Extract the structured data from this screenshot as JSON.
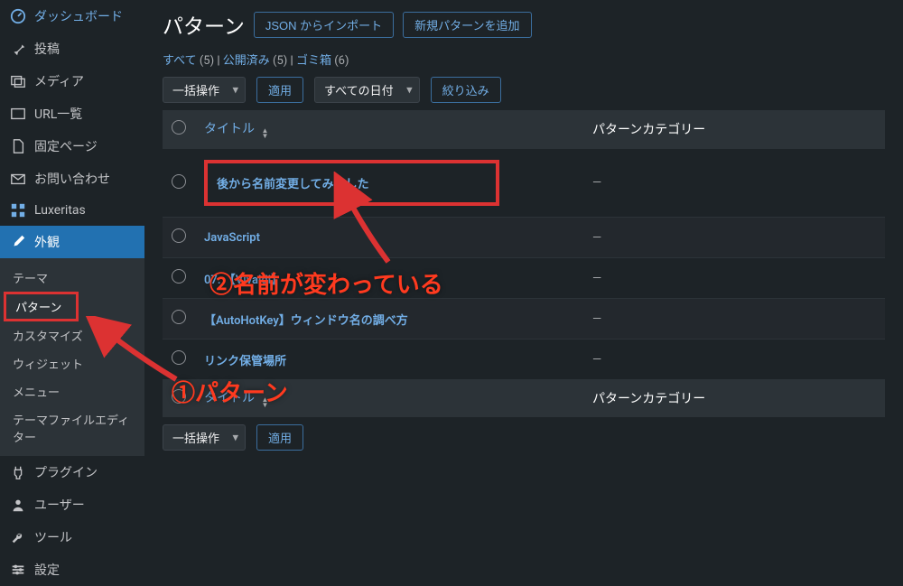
{
  "sidebar": {
    "items": [
      {
        "label": "ダッシュボード",
        "icon": "dashboard"
      },
      {
        "label": "投稿",
        "icon": "pin"
      },
      {
        "label": "メディア",
        "icon": "media"
      },
      {
        "label": "URL一覧",
        "icon": "link"
      },
      {
        "label": "固定ページ",
        "icon": "page"
      },
      {
        "label": "お問い合わせ",
        "icon": "mail"
      },
      {
        "label": "Luxeritas",
        "icon": "grid"
      },
      {
        "label": "外観",
        "icon": "brush",
        "active": true
      },
      {
        "label": "プラグイン",
        "icon": "plugin"
      },
      {
        "label": "ユーザー",
        "icon": "users"
      },
      {
        "label": "ツール",
        "icon": "tools"
      },
      {
        "label": "設定",
        "icon": "settings"
      }
    ],
    "submenu": [
      {
        "label": "テーマ"
      },
      {
        "label": "パターン",
        "highlighted": true
      },
      {
        "label": "カスタマイズ"
      },
      {
        "label": "ウィジェット"
      },
      {
        "label": "メニュー"
      },
      {
        "label": "テーマファイルエディター"
      }
    ]
  },
  "header": {
    "title": "パターン",
    "import_btn": "JSON からインポート",
    "add_btn": "新規パターンを追加"
  },
  "views": {
    "all_label": "すべて",
    "all_count": "(5)",
    "published_label": "公開済み",
    "published_count": "(5)",
    "trash_label": "ゴミ箱",
    "trash_count": "(6)"
  },
  "filters": {
    "bulk_action": "一括操作",
    "apply": "適用",
    "all_dates": "すべての日付",
    "filter": "絞り込み"
  },
  "columns": {
    "title": "タイトル",
    "category": "パターンカテゴリー"
  },
  "rows": [
    {
      "title": "後から名前変更してみました",
      "category": "—",
      "highlighted": true
    },
    {
      "title": "JavaScript",
      "category": "—"
    },
    {
      "title": "07. 【Vivaldi】",
      "category": "—"
    },
    {
      "title": "【AutoHotKey】ウィンドウ名の調べ方",
      "category": "—"
    },
    {
      "title": "リンク保管場所",
      "category": "—"
    }
  ],
  "annotations": {
    "note2": "②名前が変わっている",
    "note1": "①パターン"
  }
}
